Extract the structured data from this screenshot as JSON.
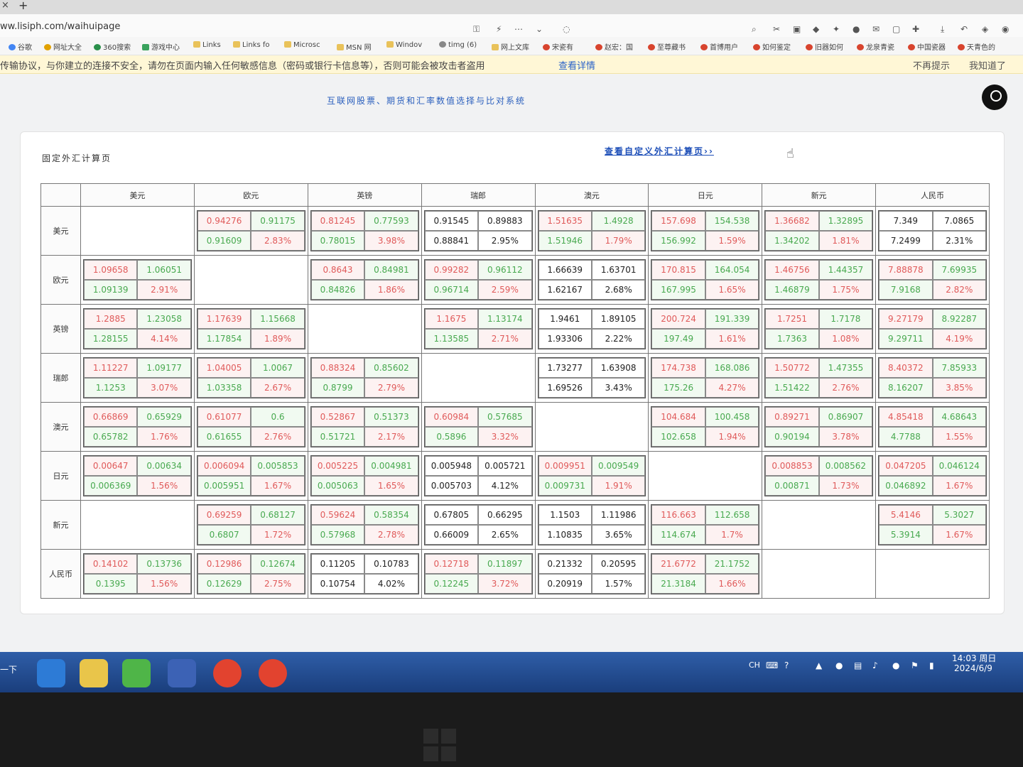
{
  "browser": {
    "url": "ww.lisiph.com/waihuipage",
    "bookmarks": [
      "谷歌",
      "网址大全",
      "360搜索",
      "游戏中心",
      "Links",
      "Links fo",
      "Microsc",
      "MSN 网",
      "Windov",
      "timg (6)",
      "网上文库",
      "宋瓷有",
      "赵宏：国",
      "至尊藏书",
      "首博用户",
      "如何鉴定",
      "旧器如何",
      "龙泉青瓷",
      "中国瓷器",
      "天青色的"
    ],
    "warning": {
      "text": "传输协议，与你建立的连接不安全，请勿在页面内输入任何敏感信息（密码或银行卡信息等），否则可能会被攻击者盗用",
      "link": "查看详情",
      "dismiss": "不再提示",
      "ok": "我知道了"
    }
  },
  "page": {
    "header": "互联网股票、期货和汇率数值选择与比对系统",
    "card_title": "固定外汇计算页",
    "custom_link": "查看自定义外汇计算页››"
  },
  "table": {
    "currencies": [
      "美元",
      "欧元",
      "英镑",
      "瑞郎",
      "澳元",
      "日元",
      "新元",
      "人民币"
    ],
    "rows": [
      [
        null,
        [
          "0.94276",
          "0.91175",
          "0.91609",
          "2.83%",
          "r"
        ],
        [
          "0.81245",
          "0.77593",
          "0.78015",
          "3.98%",
          "r"
        ],
        [
          "0.91545",
          "0.89883",
          "0.88841",
          "2.95%",
          "d"
        ],
        [
          "1.51635",
          "1.4928",
          "1.51946",
          "1.79%",
          "r"
        ],
        [
          "157.698",
          "154.538",
          "156.992",
          "1.59%",
          "r"
        ],
        [
          "1.36682",
          "1.32895",
          "1.34202",
          "1.81%",
          "r"
        ],
        [
          "7.349",
          "7.0865",
          "7.2499",
          "2.31%",
          "d"
        ]
      ],
      [
        [
          "1.09658",
          "1.06051",
          "1.09139",
          "2.91%",
          "r"
        ],
        null,
        [
          "0.8643",
          "0.84981",
          "0.84826",
          "1.86%",
          "r"
        ],
        [
          "0.99282",
          "0.96112",
          "0.96714",
          "2.59%",
          "r"
        ],
        [
          "1.66639",
          "1.63701",
          "1.62167",
          "2.68%",
          "d"
        ],
        [
          "170.815",
          "164.054",
          "167.995",
          "1.65%",
          "r"
        ],
        [
          "1.46756",
          "1.44357",
          "1.46879",
          "1.75%",
          "r"
        ],
        [
          "7.88878",
          "7.69935",
          "7.9168",
          "2.82%",
          "r"
        ]
      ],
      [
        [
          "1.2885",
          "1.23058",
          "1.28155",
          "4.14%",
          "r"
        ],
        [
          "1.17639",
          "1.15668",
          "1.17854",
          "1.89%",
          "r"
        ],
        null,
        [
          "1.1675",
          "1.13174",
          "1.13585",
          "2.71%",
          "r"
        ],
        [
          "1.9461",
          "1.89105",
          "1.93306",
          "2.22%",
          "d"
        ],
        [
          "200.724",
          "191.339",
          "197.49",
          "1.61%",
          "r"
        ],
        [
          "1.7251",
          "1.7178",
          "1.7363",
          "1.08%",
          "r"
        ],
        [
          "9.27179",
          "8.92287",
          "9.29711",
          "4.19%",
          "r"
        ]
      ],
      [
        [
          "1.11227",
          "1.09177",
          "1.1253",
          "3.07%",
          "r"
        ],
        [
          "1.04005",
          "1.0067",
          "1.03358",
          "2.67%",
          "r"
        ],
        [
          "0.88324",
          "0.85602",
          "0.8799",
          "2.79%",
          "r"
        ],
        null,
        [
          "1.73277",
          "1.63908",
          "1.69526",
          "3.43%",
          "d"
        ],
        [
          "174.738",
          "168.086",
          "175.26",
          "4.27%",
          "r"
        ],
        [
          "1.50772",
          "1.47355",
          "1.51422",
          "2.76%",
          "r"
        ],
        [
          "8.40372",
          "7.85933",
          "8.16207",
          "3.85%",
          "r"
        ]
      ],
      [
        [
          "0.66869",
          "0.65929",
          "0.65782",
          "1.76%",
          "r"
        ],
        [
          "0.61077",
          "0.6",
          "0.61655",
          "2.76%",
          "r"
        ],
        [
          "0.52867",
          "0.51373",
          "0.51721",
          "2.17%",
          "r"
        ],
        [
          "0.60984",
          "0.57685",
          "0.5896",
          "3.32%",
          "r"
        ],
        null,
        [
          "104.684",
          "100.458",
          "102.658",
          "1.94%",
          "r"
        ],
        [
          "0.89271",
          "0.86907",
          "0.90194",
          "3.78%",
          "r"
        ],
        [
          "4.85418",
          "4.68643",
          "4.7788",
          "1.55%",
          "r"
        ]
      ],
      [
        [
          "0.00647",
          "0.00634",
          "0.006369",
          "1.56%",
          "r"
        ],
        [
          "0.006094",
          "0.005853",
          "0.005951",
          "1.67%",
          "r"
        ],
        [
          "0.005225",
          "0.004981",
          "0.005063",
          "1.65%",
          "r"
        ],
        [
          "0.005948",
          "0.005721",
          "0.005703",
          "4.12%",
          "d"
        ],
        [
          "0.009951",
          "0.009549",
          "0.009731",
          "1.91%",
          "r"
        ],
        null,
        [
          "0.008853",
          "0.008562",
          "0.00871",
          "1.73%",
          "r"
        ],
        [
          "0.047205",
          "0.046124",
          "0.046892",
          "1.67%",
          "r"
        ]
      ],
      [
        null,
        [
          "0.69259",
          "0.68127",
          "0.6807",
          "1.72%",
          "r"
        ],
        [
          "0.59624",
          "0.58354",
          "0.57968",
          "2.78%",
          "r"
        ],
        [
          "0.67805",
          "0.66295",
          "0.66009",
          "2.65%",
          "d"
        ],
        [
          "1.1503",
          "1.11986",
          "1.10835",
          "3.65%",
          "d"
        ],
        [
          "116.663",
          "112.658",
          "114.674",
          "1.7%",
          "r"
        ],
        null,
        [
          "5.4146",
          "5.3027",
          "5.3914",
          "1.67%",
          "r"
        ]
      ],
      [
        [
          "0.14102",
          "0.13736",
          "0.1395",
          "1.56%",
          "r"
        ],
        [
          "0.12986",
          "0.12674",
          "0.12629",
          "2.75%",
          "r"
        ],
        [
          "0.11205",
          "0.10783",
          "0.10754",
          "4.02%",
          "d"
        ],
        [
          "0.12718",
          "0.11897",
          "0.12245",
          "3.72%",
          "r"
        ],
        [
          "0.21332",
          "0.20595",
          "0.20919",
          "1.57%",
          "d"
        ],
        [
          "21.6772",
          "21.1752",
          "21.3184",
          "1.66%",
          "r"
        ],
        null,
        null
      ]
    ]
  },
  "taskbar": {
    "start": "一下",
    "lang": "CH",
    "time": "14:03 周日",
    "date": "2024/6/9"
  }
}
